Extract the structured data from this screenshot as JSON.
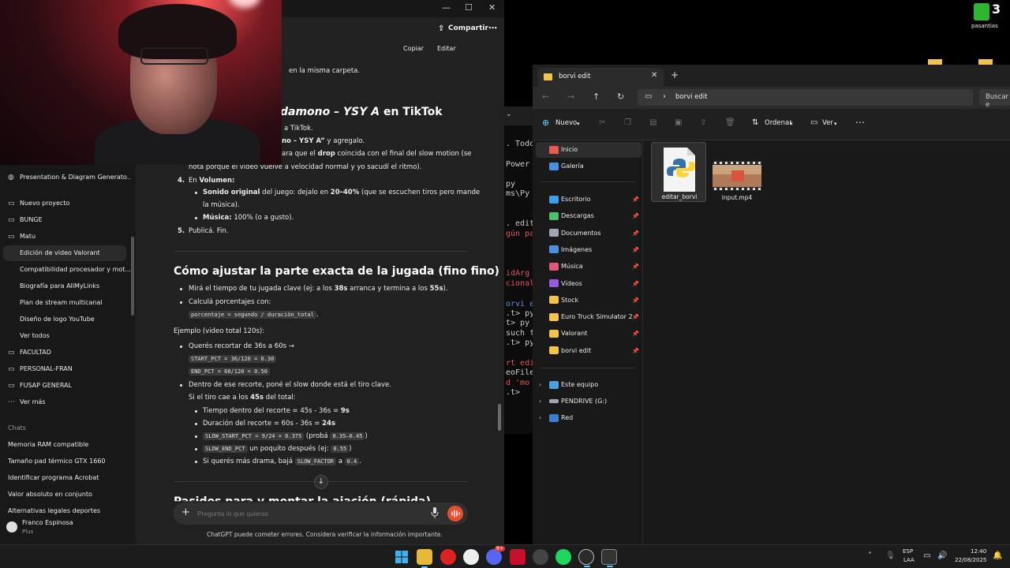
{
  "chatgpt": {
    "header": {
      "share": "Compartir",
      "more": "⋯",
      "copy": "Copiar",
      "edit": "Editar"
    },
    "window": {
      "minimize": "—",
      "maximize": "☐",
      "close": "✕"
    },
    "sidebar": {
      "gpt_item": "Presentation & Diagram Generato...",
      "new_project": "Nuevo proyecto",
      "folders": [
        "BUNGE",
        "Matu"
      ],
      "matu_items": [
        "Edición de video Valorant",
        "Compatibilidad procesador y mot...",
        "Biografía para AllMyLinks",
        "Plan de stream multicanal",
        "Diseño de logo YouTube",
        "Ver todos"
      ],
      "folders2": [
        "FACULTAD",
        "PERSONAL-FRAN",
        "FUSAP GENERAL"
      ],
      "see_more": "Ver más",
      "chats_label": "Chats",
      "chats": [
        "Memoria RAM compatible",
        "Tamaño pad térmico GTX 1660",
        "Identificar programa Acrobat",
        "Valor absoluto en conjunto",
        "Alternativas legales deportes"
      ],
      "user_name": "Franco Espinosa",
      "user_plan": "Plus"
    },
    "content": {
      "l0": "en la misma carpeta.",
      "h_tiktok_italic": "damono – YSY A",
      "h_tiktok_rest": " en TikTok",
      "l1": "a TikTok.",
      "l2a": "no – YSY A”",
      "l2b": " y agregalo.",
      "l3a": "ara que el ",
      "l3b": "drop",
      "l3c": " coincida con el final del slow motion (se",
      "l4": "nota porque el video vuelve a velocidad normal y yo sacudí el ritmo).",
      "n4": "4.",
      "l5a": "En ",
      "l5b": "Volumen:",
      "l6a": "Sonido original",
      "l6b": " del juego: dejalo en ",
      "l6c": "20–40%",
      "l6d": " (que se escuchen tiros pero mande",
      "l7": "la música).",
      "l8a": "Música:",
      "l8b": " 100% (o a gusto).",
      "n5": "5.",
      "l9": "Publicá. Fin.",
      "h_exact": "Cómo ajustar la parte exacta de la jugada (fino fino)",
      "b1a": "Mirá el tiempo de tu jugada clave (ej: a los ",
      "b1b": "38s",
      "b1c": " arranca y termina a los ",
      "b1d": "55s",
      "b1e": ").",
      "b2": "Calculá porcentajes con:",
      "code1": "porcentaje = segundo / duración_total",
      "code1_tail": ".",
      "ex": "Ejemplo (video total 120s):",
      "b3": "Querés recortar de 36s a 60s →",
      "code2": "START_PCT = 36/120 = 0.30",
      "code3": "END_PCT = 60/120 = 0.50",
      "b4": "Dentro de ese recorte, poné el slow donde está el tiro clave.",
      "b5a": "Si el tiro cae a los ",
      "b5b": "45s",
      "b5c": " del total:",
      "s1a": "Tiempo dentro del recorte = 45s - 36s = ",
      "s1b": "9s",
      "s2a": "Duración del recorte = 60s - 36s = ",
      "s2b": "24s",
      "s3_code": "SLOW_START_PCT = 9/24 = 0.375",
      "s3_mid": " (probá ",
      "s3_code2": "0.35–0.45",
      "s3_end": ")",
      "s4_code": "SLOW_END_PCT",
      "s4_mid": " un poquito después (ej: ",
      "s4_code2": "0.55",
      "s4_end": ")",
      "s5a": "Si querés más drama, bajá ",
      "s5_code": "SLOW_FACTOR",
      "s5b": " a ",
      "s5_code2": "0.4",
      "s5c": ".",
      "cut_heading": "Pasidos para y montar la ajación (rápida)"
    },
    "input_placeholder": "Pregunta lo que quieras",
    "disclaimer": "ChatGPT puede cometer errores. Considera verificar la información importante."
  },
  "terminal": {
    "lines": [
      ". Todo",
      "Power",
      "py",
      "ms\\Py",
      ". edit",
      "gún pa",
      "idArg",
      "cionalU",
      "orvi e",
      ".t> py",
      "t> py",
      "such f",
      ".t> py",
      "rt edi",
      "eoFile",
      "d 'mo",
      ".t>"
    ]
  },
  "explorer": {
    "tab_title": "borvi edit",
    "tab_close": "✕",
    "new_tab": "+",
    "address": "borvi edit",
    "search_placeholder": "Buscar e",
    "toolbar": {
      "new": "Nuevo",
      "sort": "Ordenar",
      "view": "Ver",
      "more": "⋯"
    },
    "nav": {
      "home": "Inicio",
      "gallery": "Galería",
      "pinned": [
        {
          "label": "Escritorio",
          "color": "#3aa0e8"
        },
        {
          "label": "Descargas",
          "color": "#4bbf6a"
        },
        {
          "label": "Documentos",
          "color": "#9ea7b3"
        },
        {
          "label": "Imágenes",
          "color": "#4a8fe0"
        },
        {
          "label": "Música",
          "color": "#e0577a"
        },
        {
          "label": "Vídeos",
          "color": "#9a5ae0"
        },
        {
          "label": "Stock",
          "color": "#f2c44d"
        },
        {
          "label": "Euro Truck Simulator 2",
          "color": "#f2c44d"
        },
        {
          "label": "Valorant",
          "color": "#f2c44d"
        },
        {
          "label": "borvi edit",
          "color": "#f2c44d"
        }
      ],
      "this_pc": "Este equipo",
      "pendrive": "PENDRIVE (G:)",
      "network": "Red"
    },
    "files": [
      {
        "name": "editar_borvi",
        "kind": "python-file-icon"
      },
      {
        "name": "input.mp4",
        "kind": "video-thumbnail"
      }
    ]
  },
  "desktop": {
    "badge": "3",
    "label": "pasantias"
  },
  "taskbar": {
    "lang_top": "ESP",
    "lang_bottom": "LAA",
    "time": "12:40",
    "date": "22/08/2025",
    "discord_badge": "9+"
  }
}
